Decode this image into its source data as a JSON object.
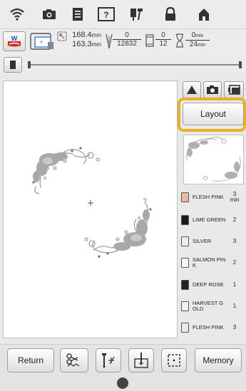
{
  "status": {
    "width_value": "168.4",
    "height_value": "163.3",
    "dim_unit": "mm",
    "stitch_current": "0",
    "stitch_total": "12832",
    "color_current": "0",
    "color_total": "12",
    "time_current": "0",
    "time_total": "24",
    "time_unit": "min"
  },
  "panel": {
    "layout_label": "Layout"
  },
  "threads": [
    {
      "name": "FLESH PINK",
      "count": "3",
      "unit": "min",
      "color": "#e9b7a3"
    },
    {
      "name": "LIME GREEN",
      "count": "2",
      "unit": "",
      "color": "#1a1a1a"
    },
    {
      "name": "SILVER",
      "count": "3",
      "unit": "",
      "color": "#ededed"
    },
    {
      "name": "SALMON PIN K",
      "count": "2",
      "unit": "",
      "color": "#f4f4f4"
    },
    {
      "name": "DEEP ROSE",
      "count": "1",
      "unit": "",
      "color": "#222222"
    },
    {
      "name": "HARVEST G OLD",
      "count": "1",
      "unit": "",
      "color": "#f2f2f2"
    },
    {
      "name": "FLESH PINK",
      "count": "3",
      "unit": "",
      "color": "#e9e9e9"
    }
  ],
  "bottom": {
    "return_label": "Return",
    "memory_label": "Memory"
  }
}
